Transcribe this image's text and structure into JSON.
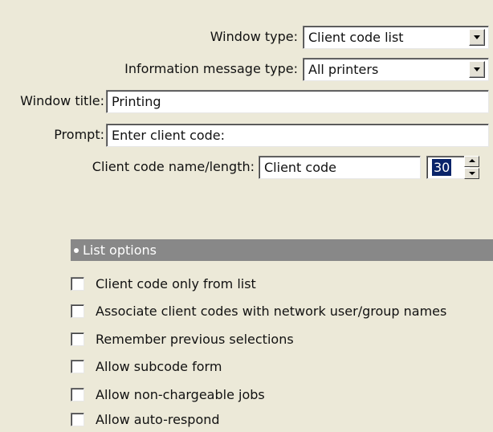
{
  "form": {
    "window_type": {
      "label": "Window type:",
      "value": "Client code list"
    },
    "info_message_type": {
      "label": "Information message type:",
      "value": "All printers"
    },
    "window_title": {
      "label": "Window title:",
      "value": "Printing"
    },
    "prompt": {
      "label": "Prompt:",
      "value": "Enter client code:"
    },
    "client_code": {
      "label": "Client code name/length:",
      "name_value": "Client code",
      "length_value": "30"
    }
  },
  "list_options": {
    "header": "List options",
    "items": [
      {
        "label": "Client code only from list",
        "checked": false
      },
      {
        "label": "Associate client codes with network user/group names",
        "checked": false
      },
      {
        "label": "Remember previous selections",
        "checked": false
      },
      {
        "label": "Allow subcode form",
        "checked": false
      },
      {
        "label": "Allow non-chargeable jobs",
        "checked": false
      },
      {
        "label": "Allow auto-respond",
        "checked": false
      }
    ]
  },
  "colors": {
    "background": "#ece9d8",
    "section_header": "#888888",
    "selection": "#0a246a"
  },
  "icons": {
    "dropdown": "chevron-down-icon",
    "spinner_up": "spin-up-icon",
    "spinner_down": "spin-down-icon",
    "bullet": "bullet-icon"
  }
}
